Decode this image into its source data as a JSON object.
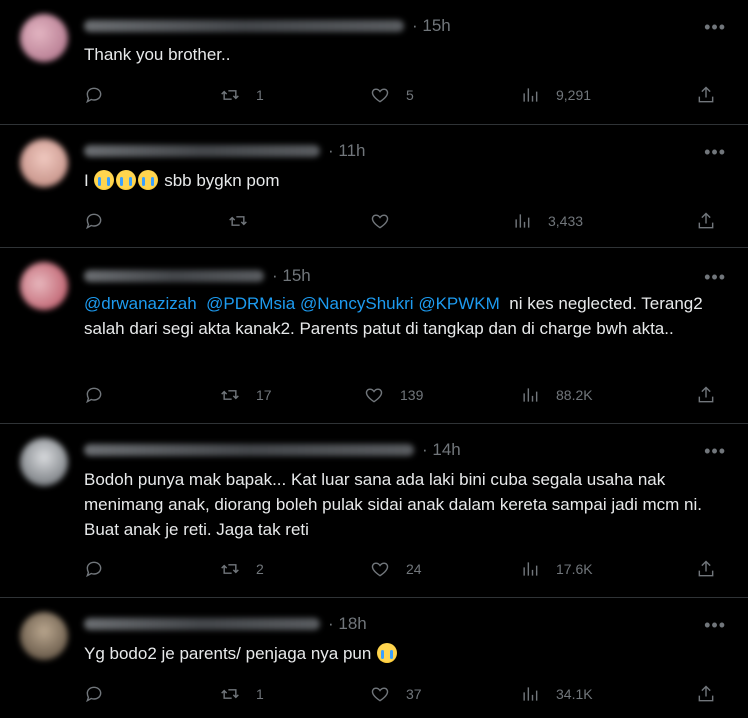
{
  "tweets": [
    {
      "time": "· 15h",
      "text": "Thank you brother..",
      "replies": "",
      "retweets": "1",
      "likes": "5",
      "views": "9,291",
      "avatar_color": "#c98aa0"
    },
    {
      "time": "· 11h",
      "text_prefix": "I",
      "text_suffix": "sbb bygkn pom",
      "emoji_name": "loudly-crying-face",
      "replies": "",
      "retweets": "",
      "likes": "",
      "views": "3,433",
      "avatar_color": "#d8a49a"
    },
    {
      "time": "· 15h",
      "mentions": [
        "@drwanazizah",
        "@PDRMsia",
        "@NancyShukri",
        "@KPWKM"
      ],
      "text_after_mentions": "ni kes neglected.",
      "text_rest": "Terang2 salah dari segi akta kanak2. Parents patut di tangkap dan di charge bwh akta..",
      "replies": "",
      "retweets": "17",
      "likes": "139",
      "views": "88.2K",
      "avatar_color": "#c5606e"
    },
    {
      "time": "· 14h",
      "text": "Bodoh punya mak bapak... Kat luar sana ada laki bini cuba segala usaha nak menimang anak, diorang boleh pulak sidai anak dalam kereta sampai jadi mcm ni. Buat anak je reti. Jaga tak reti",
      "replies": "",
      "retweets": "2",
      "likes": "24",
      "views": "17.6K",
      "avatar_color": "#8a8f96"
    },
    {
      "time": "· 18h",
      "text": "Yg bodo2 je parents/ penjaga nya pun",
      "emoji_name": "loudly-crying-face",
      "replies": "",
      "retweets": "1",
      "likes": "37",
      "views": "34.1K",
      "avatar_color": "#7b6a55"
    }
  ],
  "icons": {
    "more": "•••"
  }
}
